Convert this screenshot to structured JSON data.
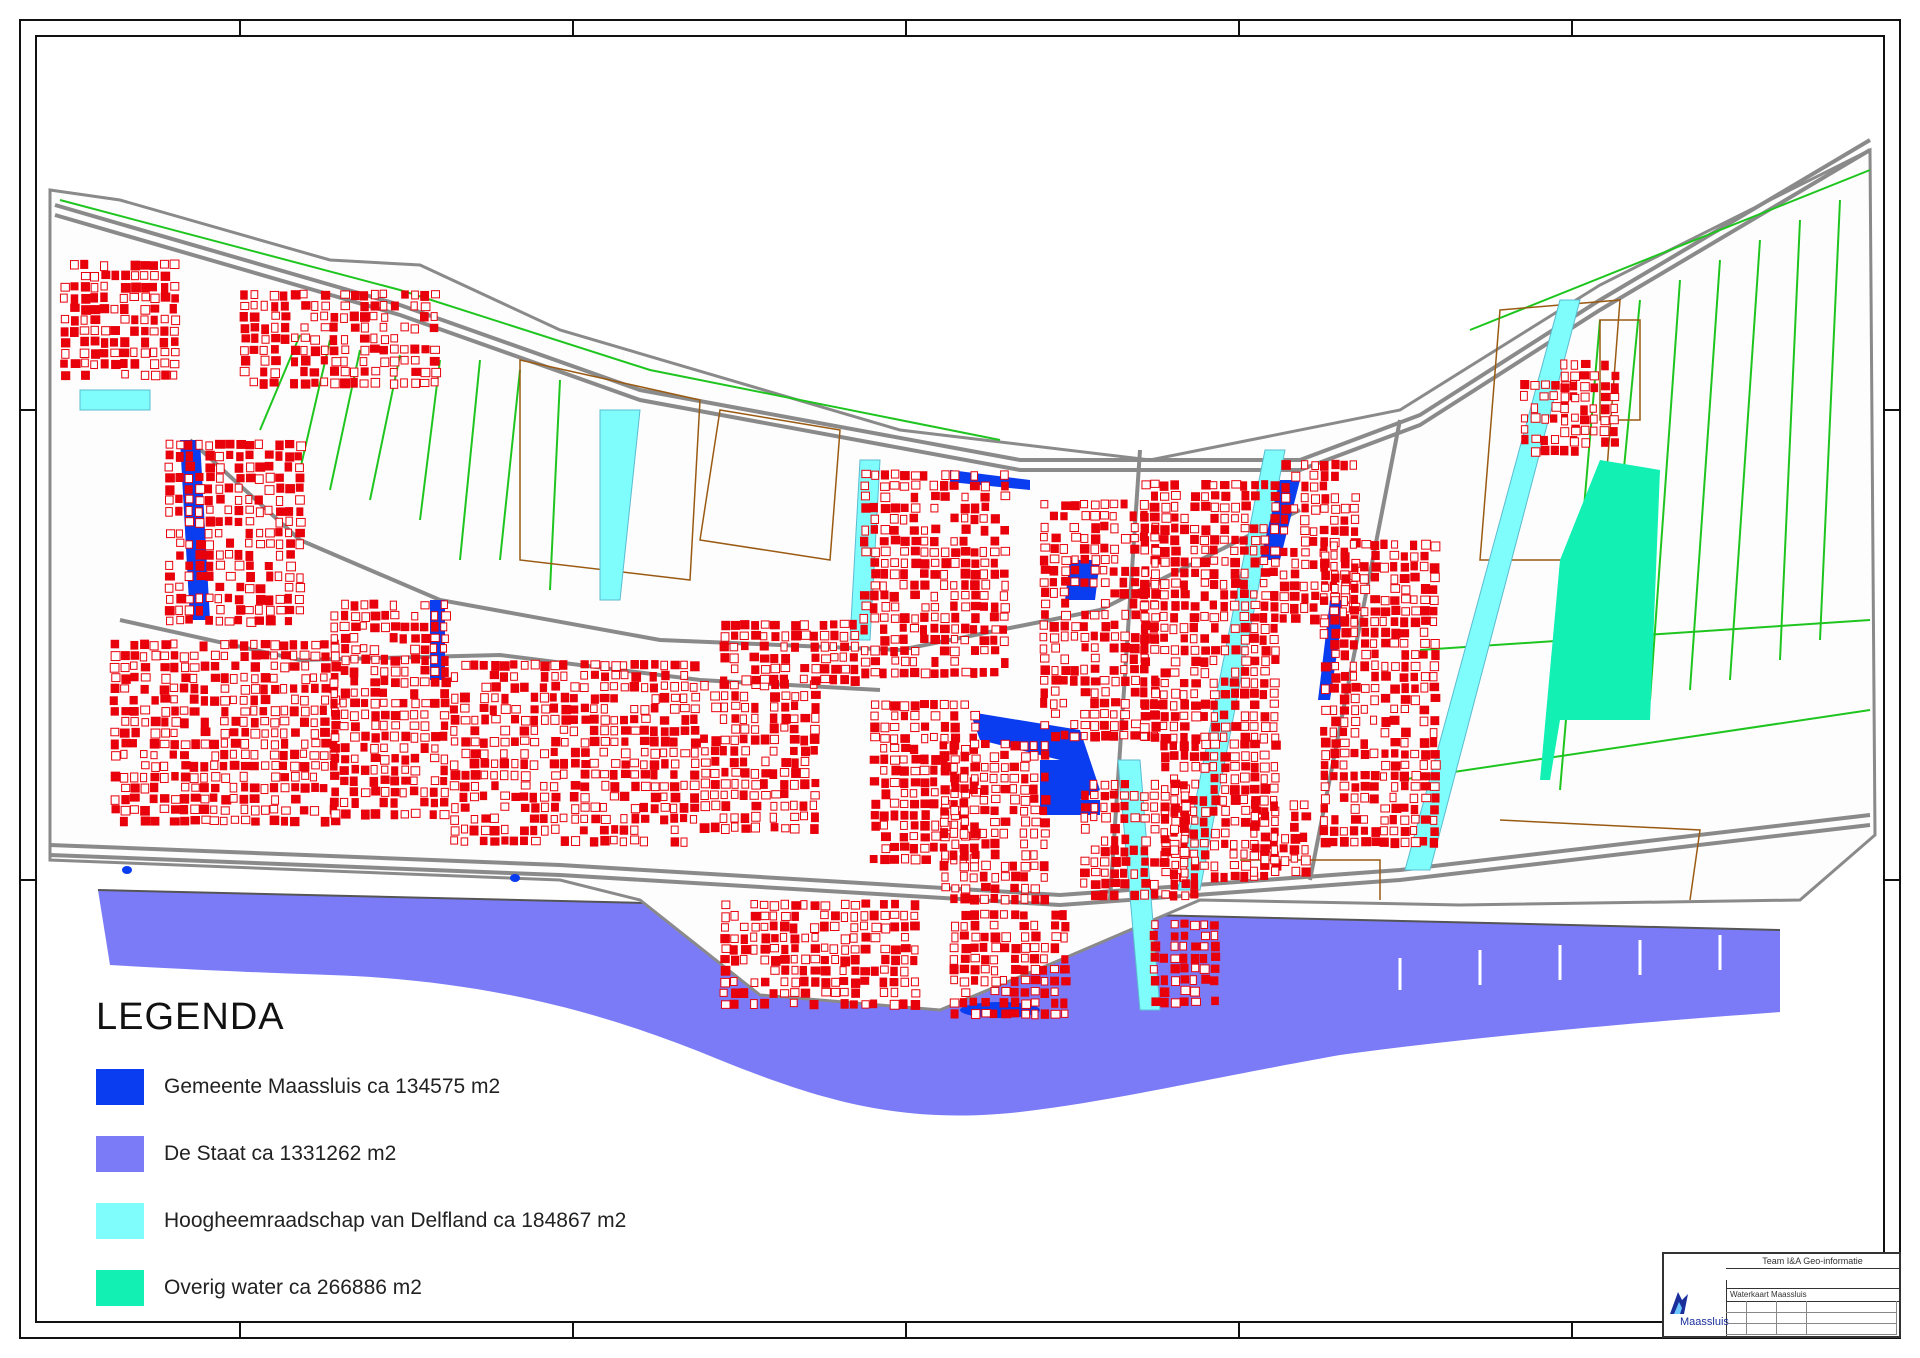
{
  "legend": {
    "title": "LEGENDA",
    "items": [
      {
        "label": "Gemeente Maassluis ca  134575  m2",
        "color": "#0a3cf0"
      },
      {
        "label": "De  Staat ca  1331262  m2",
        "color": "#7b7bf7"
      },
      {
        "label": "Hoogheemraadschap  van  Delfland  ca  184867  m2",
        "color": "#7ffcfc"
      },
      {
        "label": "Overig  water ca  266886  m2",
        "color": "#12f0b4"
      }
    ]
  },
  "title_block": {
    "organization": "Team I&A Geo-informatie",
    "map_title": "Waterkaart Maassluis",
    "logo_text": "Maassluis"
  },
  "colors": {
    "buildings": "#e8000a",
    "roads": "#8a8a8a",
    "ditches_green": "#1fc51f",
    "parcels_brown": "#9a5a12",
    "frame": "#111111"
  }
}
